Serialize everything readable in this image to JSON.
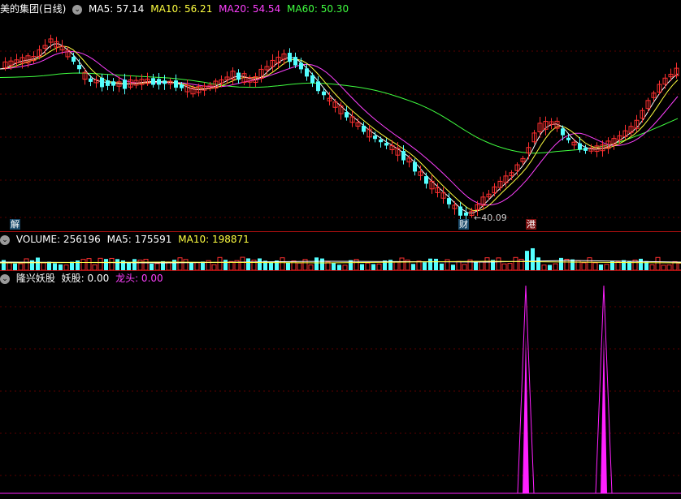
{
  "main_pane": {
    "title": "美的集团(日线)",
    "ma5_label": "MA5: 57.14",
    "ma10_label": "MA10: 56.21",
    "ma20_label": "MA20: 54.54",
    "ma60_label": "MA60: 50.30",
    "low_label": "←40.09",
    "marker_left": "解",
    "marker_mid": "财",
    "marker_right": "港"
  },
  "volume_pane": {
    "title": "VOLUME: 256196",
    "ma5_label": "MA5: 175591",
    "ma10_label": "MA10: 198871"
  },
  "indicator_pane": {
    "title": "隆兴妖股",
    "yaogu_label": "妖股: 0.00",
    "longtou_label": "龙头: 0.00"
  },
  "colors": {
    "up": "#ff3030",
    "down": "#54ffff",
    "ma5": "#ffffff",
    "ma10": "#ffff40",
    "ma20": "#ff40ff",
    "ma60": "#40ff40",
    "grid": "#5a0000",
    "signal": "#ff20ff"
  }
}
